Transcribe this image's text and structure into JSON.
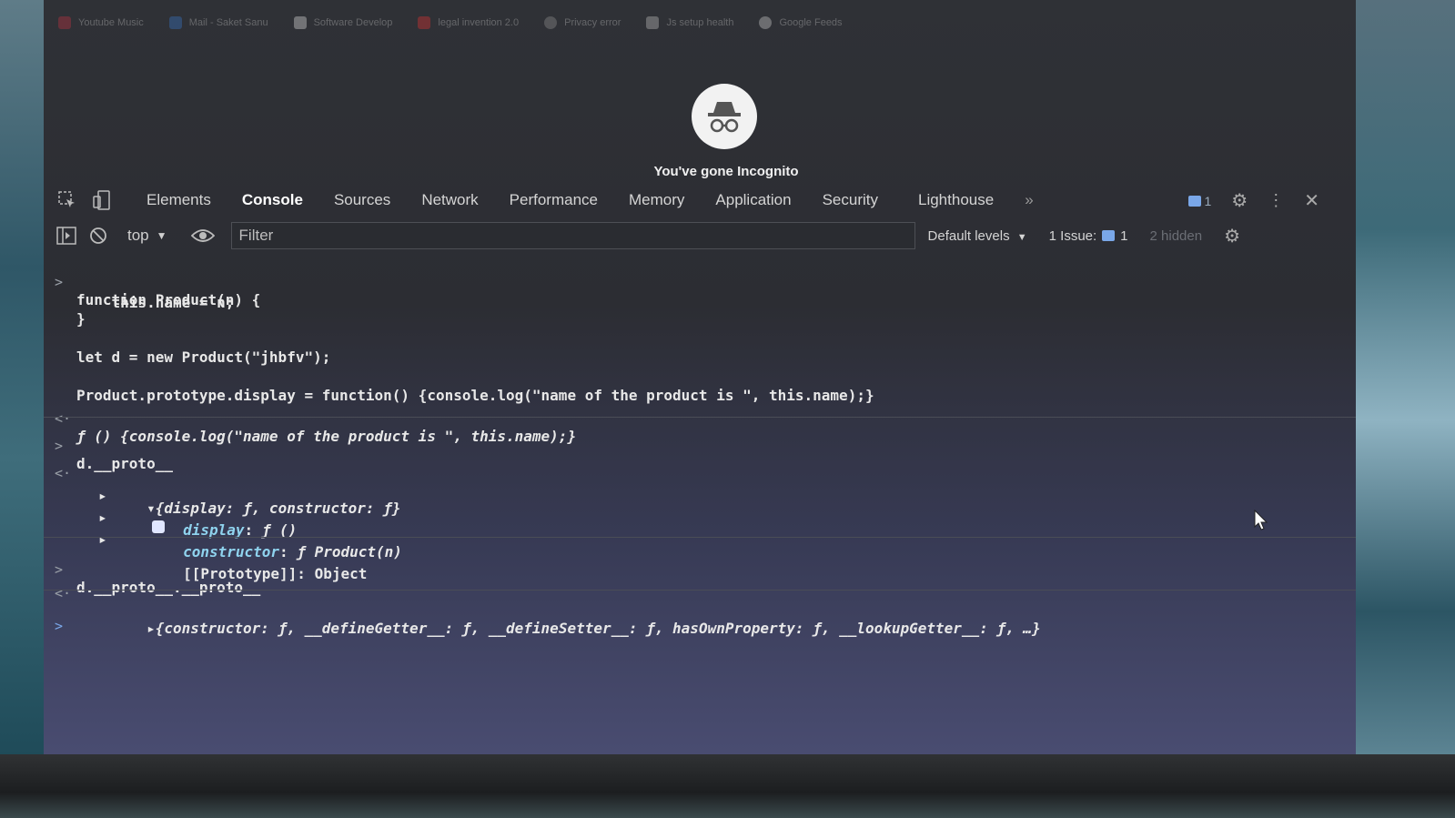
{
  "browser": {
    "tabs": [
      {
        "title": "Youtube Music"
      },
      {
        "title": "Mail - Saket Sanu"
      },
      {
        "title": "Software Develop"
      },
      {
        "title": "legal invention 2.0"
      },
      {
        "title": "Privacy error"
      },
      {
        "title": "Js setup health"
      },
      {
        "title": "Google Feeds"
      }
    ]
  },
  "incognito": {
    "text": "You've gone Incognito"
  },
  "devtools": {
    "tabs": [
      "Elements",
      "Console",
      "Sources",
      "Network",
      "Performance",
      "Memory",
      "Application",
      "Security",
      "Lighthouse"
    ],
    "active_tab": "Console",
    "more_tabs": "»",
    "messages_count": "1",
    "toolbar": {
      "context": "top",
      "filter_placeholder": "Filter",
      "levels": "Default levels",
      "issues_label": "1 Issue:",
      "issues_count": "1",
      "hidden": "2 hidden"
    }
  },
  "console": {
    "input1": {
      "l1": "function Product(n) {",
      "l2": "    this.name = n;",
      "l3": "}",
      "l4": "let d = new Product(\"jhbfv\");",
      "l5": "Product.prototype.display = function() {console.log(\"name of the product is \", this.name);}"
    },
    "output1": "ƒ () {console.log(\"name of the product is \", this.name);}",
    "input2": "d.__proto__",
    "output2": {
      "summary": "{display: ƒ, constructor: ƒ}",
      "children": [
        {
          "key": "display",
          "value": "ƒ ()"
        },
        {
          "key": "constructor",
          "value": "ƒ Product(n)"
        },
        {
          "key": "[[Prototype]]",
          "value": "Object"
        }
      ]
    },
    "input3": "d.__proto__.__proto__",
    "output3": "{constructor: ƒ, __defineGetter__: ƒ, __defineSetter__: ƒ, hasOwnProperty: ƒ, __lookupGetter__: ƒ, …}"
  }
}
